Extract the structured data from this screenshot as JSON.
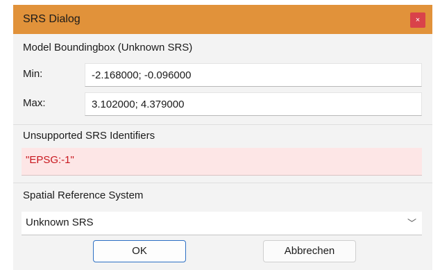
{
  "dialog": {
    "title": "SRS Dialog",
    "close_glyph": "×"
  },
  "bounding_box": {
    "title": "Model Boundingbox (Unknown SRS)",
    "min_label": "Min:",
    "min_value": "-2.168000; -0.096000",
    "max_label": "Max:",
    "max_value": "3.102000; 4.379000"
  },
  "unsupported": {
    "title": "Unsupported SRS Identifiers",
    "value": "\"EPSG:-1\""
  },
  "srs": {
    "title": "Spatial Reference System",
    "selected": "Unknown SRS",
    "arrow_glyph": "﹀"
  },
  "buttons": {
    "ok": "OK",
    "cancel": "Abbrechen"
  },
  "colors": {
    "titlebar": "#e1923a",
    "close": "#d9424a",
    "error_bg": "#fde6e6",
    "error_text": "#c8161d",
    "default_border": "#2c6fc4"
  },
  "icons": {
    "close": "close-icon",
    "dropdown": "chevron-down-icon"
  }
}
